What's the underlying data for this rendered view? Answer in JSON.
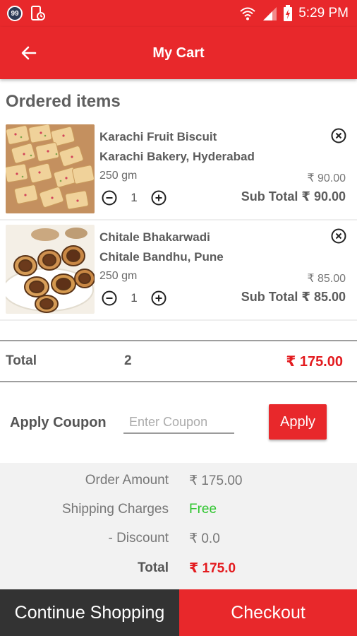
{
  "colors": {
    "brand": "#e8282b",
    "price_red": "#e31b1f",
    "free_green": "#2ec52e",
    "dark_button": "#333333",
    "summary_bg": "#f2f2f2"
  },
  "status_bar": {
    "badge": "99",
    "time": "5:29 PM",
    "icons": [
      "notification-badge-icon",
      "phone-sync-icon",
      "wifi-icon",
      "signal-icon",
      "battery-charging-icon"
    ]
  },
  "app_bar": {
    "title": "My Cart",
    "back_icon": "arrow-left-icon"
  },
  "section_title": "Ordered items",
  "items": [
    {
      "name": "Karachi Fruit Biscuit",
      "vendor": "Karachi Bakery, Hyderabad",
      "weight": "250 gm",
      "quantity": "1",
      "price": "₹ 90.00",
      "subtotal": "Sub Total ₹ 90.00",
      "image": "fruit-biscuit-photo"
    },
    {
      "name": "Chitale Bhakarwadi",
      "vendor": "Chitale Bandhu, Pune",
      "weight": "250 gm",
      "quantity": "1",
      "price": "₹ 85.00",
      "subtotal": "Sub Total ₹ 85.00",
      "image": "bhakarwadi-photo"
    }
  ],
  "total_row": {
    "label": "Total",
    "count": "2",
    "amount": "₹ 175.00"
  },
  "coupon": {
    "label": "Apply Coupon",
    "placeholder": "Enter Coupon",
    "value": "",
    "button": "Apply"
  },
  "summary": [
    {
      "key": "Order Amount",
      "value": "₹ 175.00"
    },
    {
      "key": "Shipping Charges",
      "value": "Free"
    },
    {
      "key": "- Discount",
      "value": "₹ 0.0"
    },
    {
      "key": "Total",
      "value": "₹ 175.0"
    }
  ],
  "actions": {
    "continue": "Continue Shopping",
    "checkout": "Checkout"
  }
}
